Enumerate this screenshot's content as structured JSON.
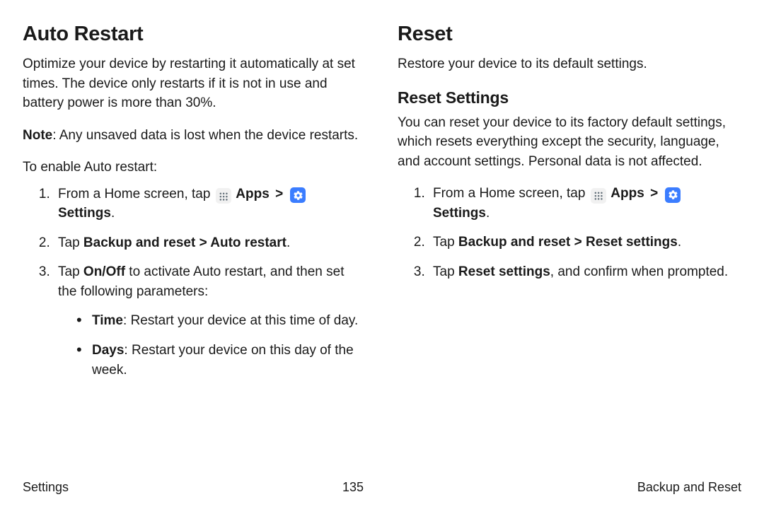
{
  "left": {
    "title": "Auto Restart",
    "intro": "Optimize your device by restarting it automatically at set times. The device only restarts if it is not in use and battery power is more than 30%.",
    "note_label": "Note",
    "note_text": ": Any unsaved data is lost when the device restarts.",
    "leadin": "To enable Auto restart:",
    "step1_prefix": "From a Home screen, tap ",
    "step1_apps": " Apps ",
    "step1_settings": " Settings",
    "step1_period": ".",
    "step2_prefix": "Tap ",
    "step2_bold": "Backup and reset > Auto restart",
    "step2_period": ".",
    "step3_prefix": "Tap ",
    "step3_bold": "On/Off",
    "step3_suffix": " to activate Auto restart, and then set the following parameters:",
    "bullet1_label": "Time",
    "bullet1_text": ": Restart your device at this time of day.",
    "bullet2_label": "Days",
    "bullet2_text": ": Restart your device on this day of the week."
  },
  "right": {
    "title": "Reset",
    "intro": "Restore your device to its default settings.",
    "sub_title": "Reset Settings",
    "sub_intro": "You can reset your device to its factory default settings, which resets everything except the security, language, and account settings. Personal data is not affected.",
    "step1_prefix": "From a Home screen, tap ",
    "step1_apps": " Apps ",
    "step1_settings": " Settings",
    "step1_period": ".",
    "step2_prefix": "Tap ",
    "step2_bold": "Backup and reset > Reset settings",
    "step2_period": ".",
    "step3_prefix": "Tap ",
    "step3_bold": "Reset settings",
    "step3_suffix": ", and confirm when prompted."
  },
  "footer": {
    "left": "Settings",
    "center": "135",
    "right": "Backup and Reset"
  },
  "chevron": ">"
}
